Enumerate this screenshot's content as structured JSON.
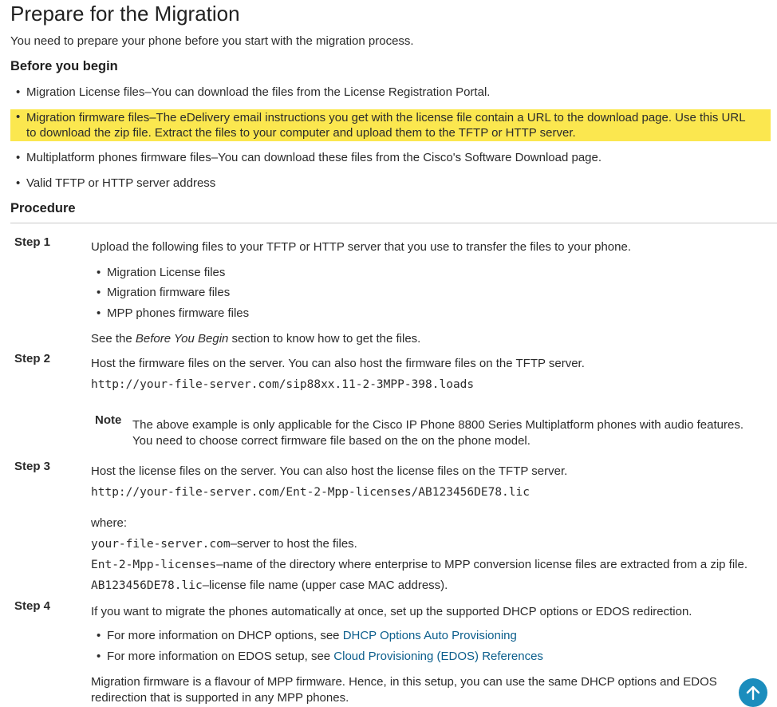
{
  "title": "Prepare for the Migration",
  "intro": "You need to prepare your phone before you start with the migration process.",
  "before_you_begin": {
    "heading": "Before you begin",
    "items": [
      "Migration License files–You can download the files from the License Registration Portal.",
      "Migration firmware files–The eDelivery email instructions you get with the license file contain a URL to the download page. Use this URL to download the zip file. Extract the files to your computer and upload them to the TFTP or HTTP server.",
      "Multiplatform phones firmware files–You can download these files from the Cisco's Software Download page.",
      "Valid TFTP or HTTP server address"
    ],
    "highlight_color": "#fbe74f"
  },
  "procedure": {
    "heading": "Procedure",
    "step1": {
      "label": "Step 1",
      "text": "Upload the following files to your TFTP or HTTP server that you use to transfer the files to your phone.",
      "bullets": [
        "Migration License files",
        "Migration firmware files",
        "MPP phones firmware files"
      ],
      "see_prefix": "See the ",
      "see_em": "Before You Begin",
      "see_suffix": " section to know how to get the files."
    },
    "step2": {
      "label": "Step 2",
      "text": "Host the firmware files on the server. You can also host the firmware files on the TFTP server.",
      "code": "http://your-file-server.com/sip88xx.11-2-3MPP-398.loads",
      "note_label": "Note",
      "note_text": "The above example is only applicable for the Cisco IP Phone 8800 Series Multiplatform phones with audio features. You need to choose correct firmware file based on the on the phone model."
    },
    "step3": {
      "label": "Step 3",
      "text": "Host the license files on the server. You can also host the license files on the TFTP server.",
      "code": "http://your-file-server.com/Ent-2-Mpp-licenses/AB123456DE78.lic",
      "where": "where:",
      "defs": [
        {
          "term": "your-file-server.com",
          "desc": "–server to host the files."
        },
        {
          "term": "Ent-2-Mpp-licenses",
          "desc": "–name of the directory where enterprise to MPP conversion license files are extracted from a zip file."
        },
        {
          "term": "AB123456DE78.lic",
          "desc": "–license file name (upper case MAC address)."
        }
      ]
    },
    "step4": {
      "label": "Step 4",
      "text": "If you want to migrate the phones automatically at once, set up the supported DHCP options or EDOS redirection.",
      "bullets": [
        {
          "prefix": "For more information on DHCP options, see ",
          "link": "DHCP Options Auto Provisioning"
        },
        {
          "prefix": "For more information on EDOS setup, see ",
          "link": "Cloud Provisioning (EDOS) References"
        }
      ],
      "final": "Migration firmware is a flavour of MPP firmware. Hence, in this setup, you can use the same DHCP options and EDOS redirection that is supported in any MPP phones."
    }
  },
  "icons": {
    "back_to_top": "arrow-up-icon"
  },
  "colors": {
    "link": "#0b5e8c",
    "back_to_top_bg": "#1b8dbd"
  }
}
